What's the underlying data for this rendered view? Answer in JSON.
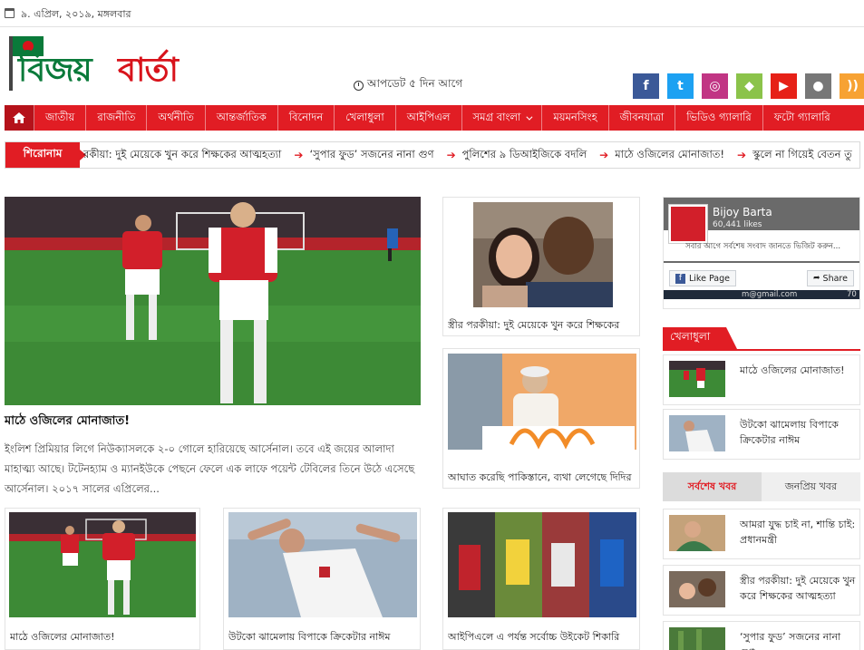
{
  "topbar": {
    "date": "৯. এপ্রিল, ২০১৯, মঙ্গলবার"
  },
  "logo": {
    "word1": "বিজয়",
    "word2": "বার্তা"
  },
  "header": {
    "updated": "আপডেট ৫ দিন আগে"
  },
  "social": [
    {
      "icon": "facebook-icon",
      "glyph": "f",
      "color": "#3b5998"
    },
    {
      "icon": "twitter-icon",
      "glyph": "t",
      "color": "#1da1f2"
    },
    {
      "icon": "instagram-icon",
      "glyph": "◎",
      "color": "#c13584"
    },
    {
      "icon": "android-icon",
      "glyph": "◆",
      "color": "#8bc34a"
    },
    {
      "icon": "youtube-icon",
      "glyph": "▶",
      "color": "#e62117"
    },
    {
      "icon": "apple-icon",
      "glyph": "●",
      "color": "#777777"
    },
    {
      "icon": "rss-icon",
      "glyph": "))",
      "color": "#f7a233"
    }
  ],
  "nav": {
    "items": [
      "জাতীয়",
      "রাজনীতি",
      "অর্থনীতি",
      "আন্তর্জাতিক",
      "বিনোদন",
      "খেলাধুলা",
      "আইপিএল",
      "সমগ্র বাংলা",
      "ময়মনসিংহ",
      "জীবনযাত্রা",
      "ভিডিও গ্যালারি",
      "ফটো গ্যালারি"
    ]
  },
  "ticker": {
    "label": "শিরোনাম",
    "items": [
      "রকীয়া: দুই মেয়েকে খুন করে শিক্ষকের আত্মহত্যা",
      "‘সুপার ফুড’ সজনের নানা গুণ",
      "পুলিশের ৯ ডিআইজিকে বদলি",
      "মাঠে ওজিলের মোনাজাত!",
      "স্কুলে না গিয়েই বেতন তু"
    ]
  },
  "feature": {
    "title": "মাঠে ওজিলের মোনাজাত!",
    "excerpt": "ইংলিশ প্রিমিয়ার লিগে নিউক্যাসলকে ২-০ গোলে হারিয়েছে আর্সেনাল। তবে এই জয়ের আলাদা মাহাত্ম্য আছে। টটেনহ্যাম ও ম্যানইউকে পেছনে ফেলে এক লাফে পয়েন্ট টেবিলের তিনে উঠে এসেছে আর্সেনাল। ২০১৭ সালের এপ্রিলের..."
  },
  "middle_cards": [
    {
      "caption": "স্ত্রীর পরকীয়া: দুই মেয়েকে খুন করে শিক্ষকের"
    },
    {
      "caption": "আঘাত করেছি পাকিস্তানে, ব্যথা লেগেছে দিদির"
    }
  ],
  "bottom_cards": [
    {
      "caption": "মাঠে ওজিলের মোনাজাত!"
    },
    {
      "caption": "উটকো ঝামেলায় বিপাকে ক্রিকেটার নাঈম"
    },
    {
      "caption": "আইপিএলে এ পর্যন্ত সর্বোচ্চ উইকেট শিকারি"
    }
  ],
  "facebook": {
    "page": "Bijoy Barta",
    "likes": "60,441 likes",
    "like_label": "Like Page",
    "share_label": "Share",
    "tagline": "সবার আগে সর্বশেষ সংবাদ জানতে ভিজিট করুন...",
    "email_fragment": "m@gmail.com",
    "corner_num": "70"
  },
  "sports": {
    "heading": "খেলাধুলা",
    "items": [
      "মাঠে ওজিলের মোনাজাত!",
      "উটকো ঝামেলায় বিপাকে ক্রিকেটার নাঈম"
    ]
  },
  "tabs": {
    "latest": "সর্বশেষ খবর",
    "popular": "জনপ্রিয় খবর"
  },
  "latest": {
    "items": [
      "আমরা যুদ্ধ চাই না, শান্তি চাই: প্রধানমন্ত্রী",
      "স্ত্রীর পরকীয়া: দুই মেয়েকে খুন করে শিক্ষকের আত্মহত্যা",
      "‘সুপার ফুড’ সজনের নানা গুণ"
    ]
  }
}
